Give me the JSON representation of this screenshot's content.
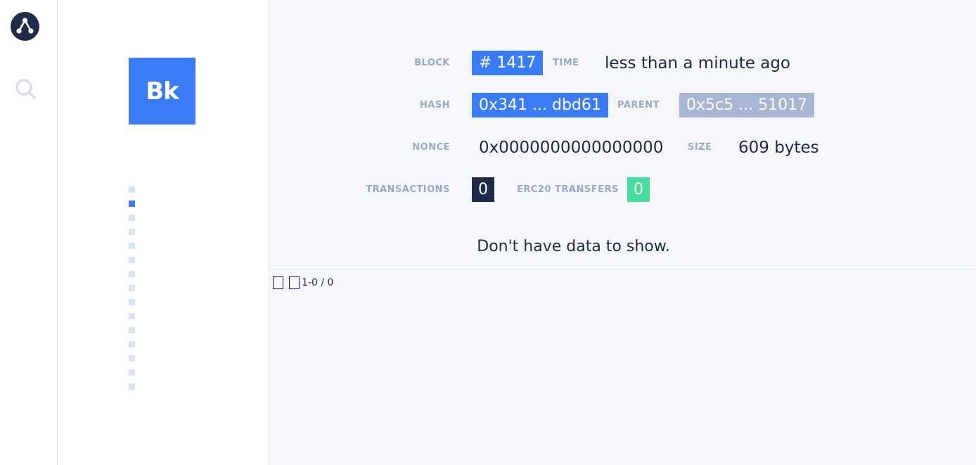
{
  "nav": {
    "logo_icon": "network-nodes-icon",
    "search_icon": "search-icon"
  },
  "side": {
    "avatar_text": "Bk",
    "dots_total": 15,
    "dots_active_index": 1
  },
  "block": {
    "block_label": "BLOCK",
    "block_value": "# 1417",
    "time_label": "TIME",
    "time_value": "less than a minute ago",
    "hash_label": "HASH",
    "hash_value": "0x341 ... dbd61",
    "parent_label": "PARENT",
    "parent_value": "0x5c5 ... 51017",
    "nonce_label": "NONCE",
    "nonce_value": "0x0000000000000000",
    "size_label": "SIZE",
    "size_value": "609 bytes",
    "transactions_label": "TRANSACTIONS",
    "transactions_value": "0",
    "erc20_label": "ERC20 TRANSFERS",
    "erc20_value": "0"
  },
  "empty_message": "Don't have data to show.",
  "pagination": {
    "info": "1-0 / 0"
  },
  "colors": {
    "accent": "#3a7bf6",
    "navy": "#1f2b4b",
    "muted_chip": "#a7b6d3",
    "green": "#45dd9c",
    "label": "#98a8c6"
  }
}
